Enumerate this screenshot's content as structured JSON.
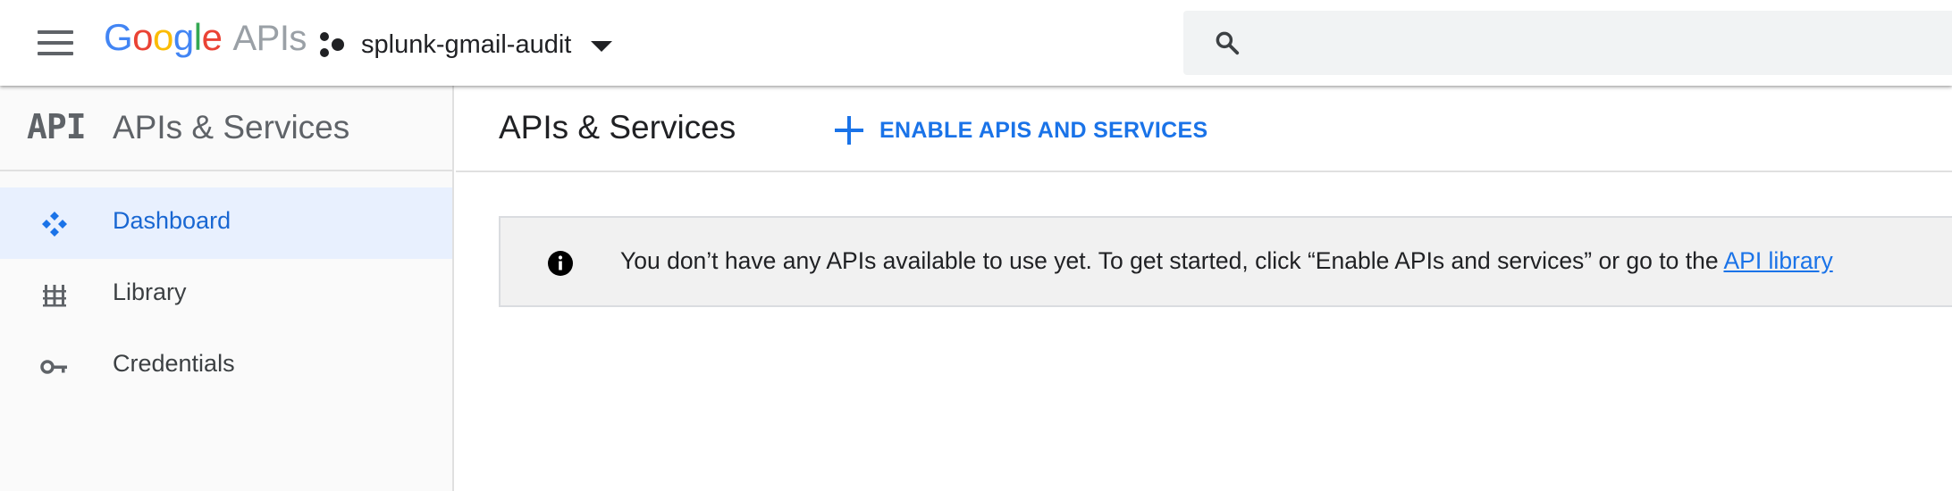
{
  "header": {
    "logo_google": "Google",
    "logo_apis": "APIs",
    "project_name": "splunk-gmail-audit",
    "search_placeholder": ""
  },
  "sidebar": {
    "badge": "API",
    "title": "APIs & Services",
    "items": [
      {
        "label": "Dashboard",
        "icon": "dashboard-icon",
        "active": true
      },
      {
        "label": "Library",
        "icon": "library-icon",
        "active": false
      },
      {
        "label": "Credentials",
        "icon": "key-icon",
        "active": false
      }
    ]
  },
  "main": {
    "title": "APIs & Services",
    "enable_button_label": "ENABLE APIS AND SERVICES",
    "info_message": "You don’t have any APIs available to use yet. To get started, click “Enable APIs and services” or go to the ",
    "info_link": "API library"
  },
  "colors": {
    "accent": "#1a73e8",
    "active_bg": "#e8f0fe",
    "google_blue": "#4285f4",
    "google_red": "#ea4335",
    "google_yellow": "#fbbc05",
    "google_green": "#34a853"
  }
}
